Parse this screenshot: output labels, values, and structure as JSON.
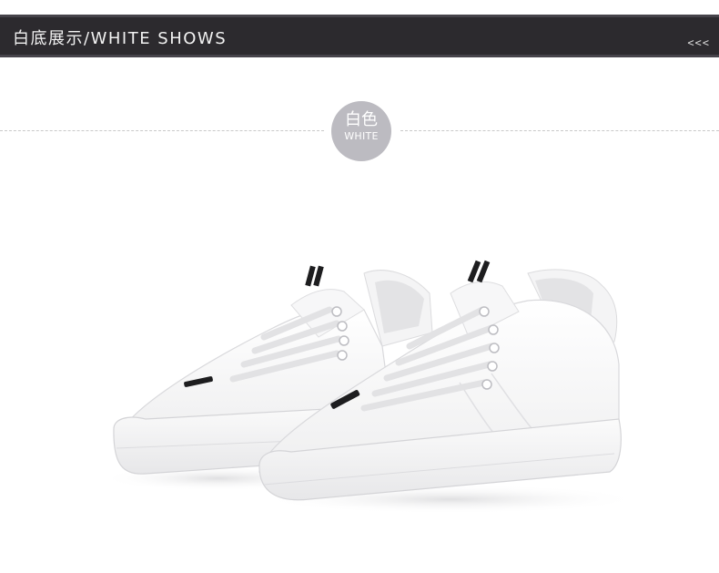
{
  "header": {
    "title": "白底展示/WHITE SHOWS",
    "arrows": "<<<"
  },
  "badge": {
    "line1": "白色",
    "line2": "WHITE",
    "color": "#bcbbc1"
  },
  "product": {
    "image_name": "white-sneakers-pair"
  }
}
